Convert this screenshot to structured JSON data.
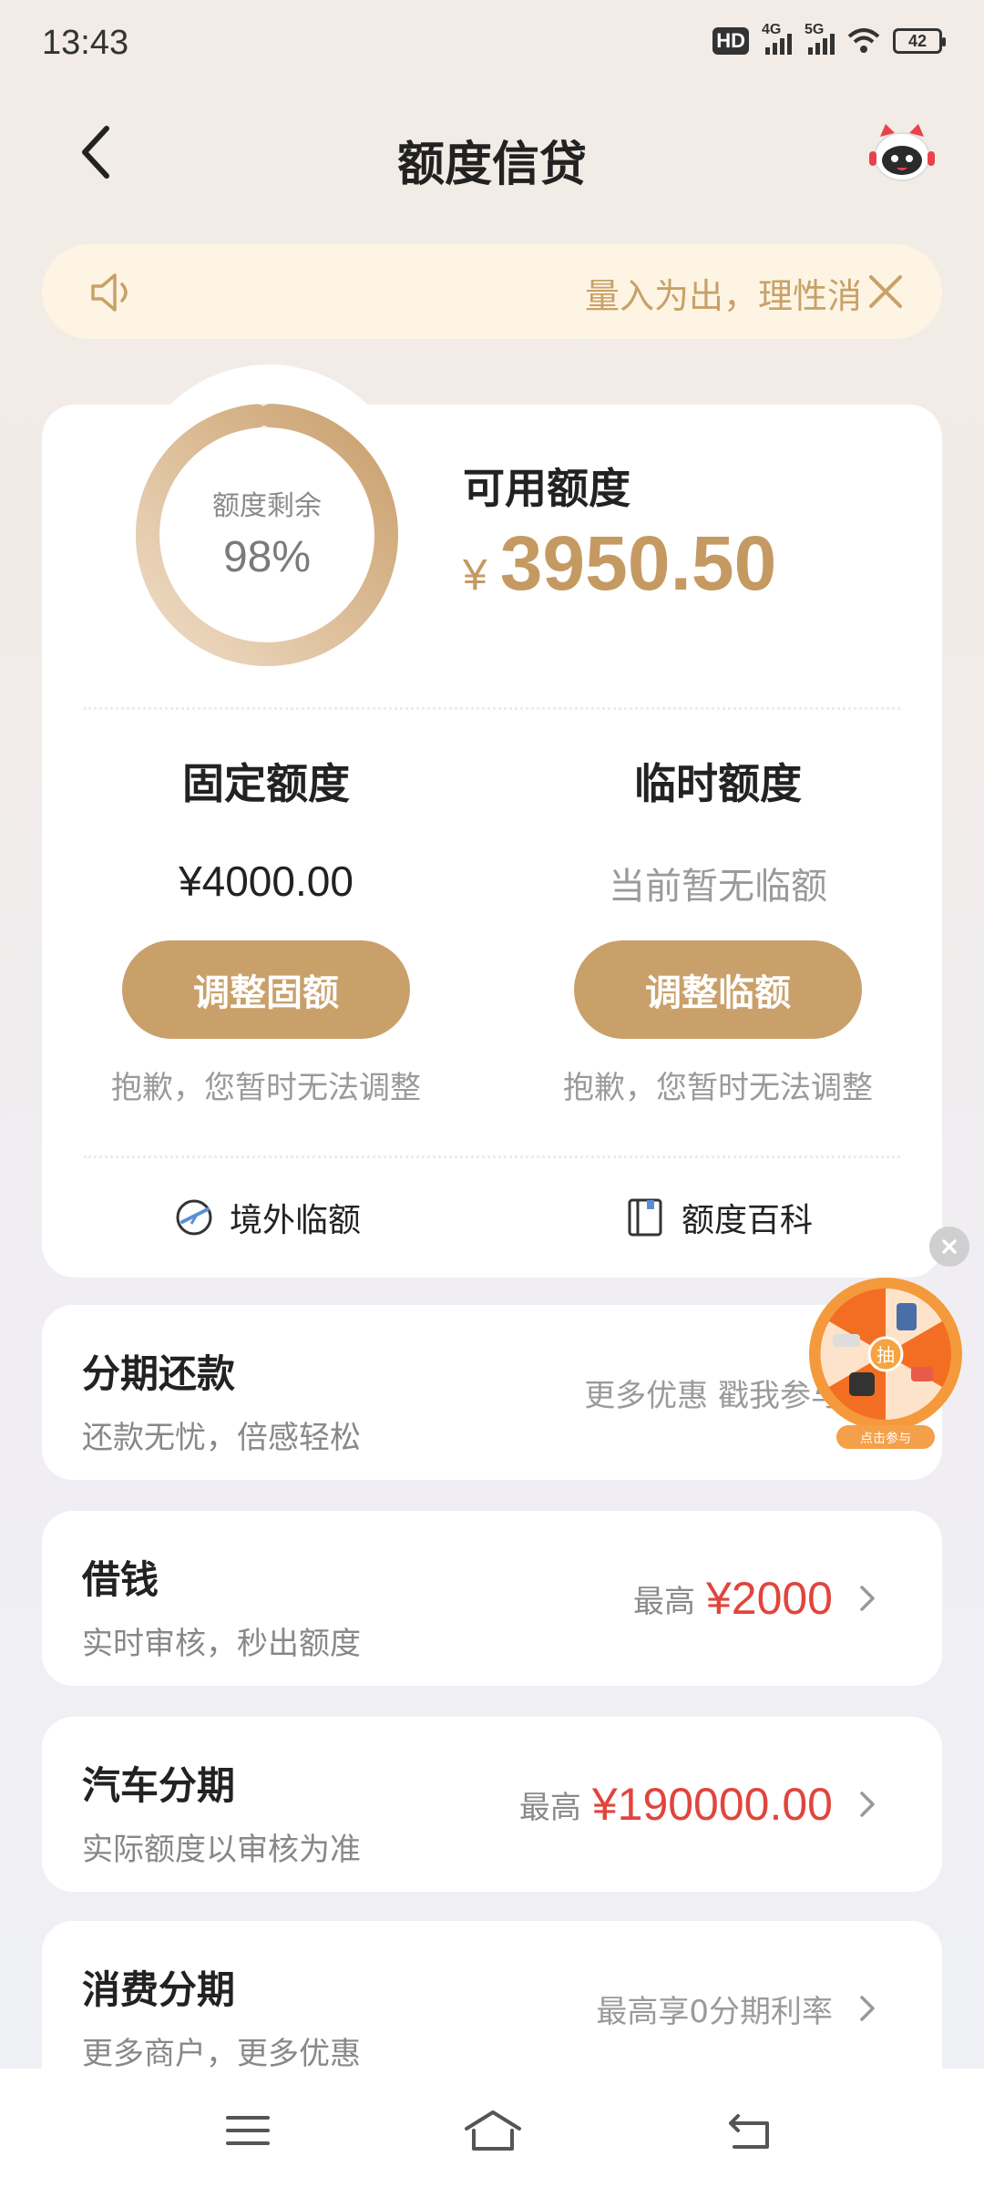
{
  "status_bar": {
    "time": "13:43",
    "hd": "HD",
    "net1": "4G",
    "net2": "5G",
    "battery": "42"
  },
  "nav": {
    "title": "额度信贷"
  },
  "notice": {
    "text": "量入为出，理性消"
  },
  "credit": {
    "ring_label": "额度剩余",
    "ring_value": "98%",
    "ring_fraction": 0.98,
    "available_label": "可用额度",
    "currency": "¥",
    "available_amount": "3950.50"
  },
  "fixed_quota": {
    "title": "固定额度",
    "value": "¥4000.00",
    "button": "调整固额",
    "note": "抱歉，您暂时无法调整"
  },
  "temp_quota": {
    "title": "临时额度",
    "value": "当前暂无临额",
    "button": "调整临额",
    "note": "抱歉，您暂时无法调整"
  },
  "links": {
    "overseas": "境外临额",
    "wiki": "额度百科"
  },
  "list": [
    {
      "title": "分期还款",
      "sub": "还款无忧，倍感轻松",
      "hint": "更多优惠 戳我参与"
    },
    {
      "title": "借钱",
      "sub": "实时审核，秒出额度",
      "prefix": "最高",
      "amount": "¥2000"
    },
    {
      "title": "汽车分期",
      "sub": "实际额度以审核为准",
      "prefix": "最高",
      "amount": "¥190000.00"
    },
    {
      "title": "消费分期",
      "sub": "更多商户，更多优惠",
      "hint": "最高享0分期利率"
    }
  ],
  "wheel": {
    "center": "抽",
    "label": "点击参与"
  },
  "colors": {
    "accent": "#c9a06a",
    "amount_red": "#e0453d",
    "notice_bg": "#fdf4e3"
  }
}
